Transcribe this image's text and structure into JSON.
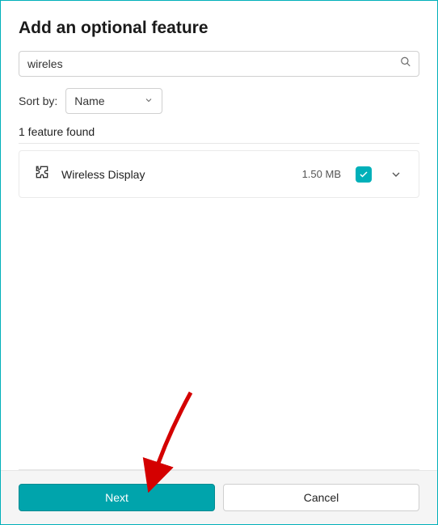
{
  "title": "Add an optional feature",
  "search": {
    "value": "wireles"
  },
  "sort": {
    "label": "Sort by:",
    "selected": "Name"
  },
  "count_text": "1 feature found",
  "features": [
    {
      "name": "Wireless Display",
      "size": "1.50 MB",
      "checked": true
    }
  ],
  "actions": {
    "next": "Next",
    "cancel": "Cancel"
  }
}
